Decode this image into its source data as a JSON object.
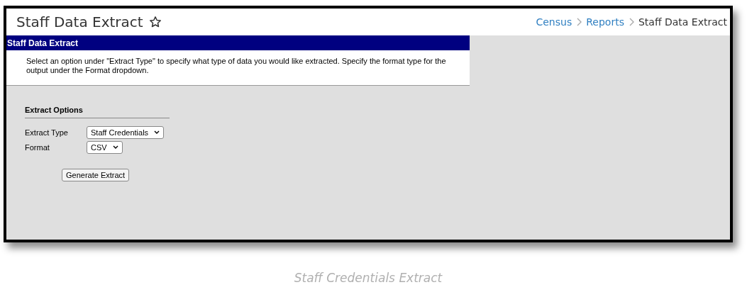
{
  "page_title": "Staff Data Extract",
  "breadcrumbs": [
    {
      "label": "Census",
      "kind": "link"
    },
    {
      "label": "Reports",
      "kind": "link"
    },
    {
      "label": "Staff Data Extract",
      "kind": "current"
    }
  ],
  "panel": {
    "title": "Staff Data Extract",
    "description": "Select an option under \"Extract Type\" to specify what type of data you would like extracted. Specify the format type for the output under the Format dropdown."
  },
  "section_title": "Extract Options",
  "fields": [
    {
      "label": "Extract Type",
      "value": "Staff Credentials"
    },
    {
      "label": "Format",
      "value": "CSV"
    }
  ],
  "button": "Generate Extract",
  "caption": "Staff Credentials Extract"
}
